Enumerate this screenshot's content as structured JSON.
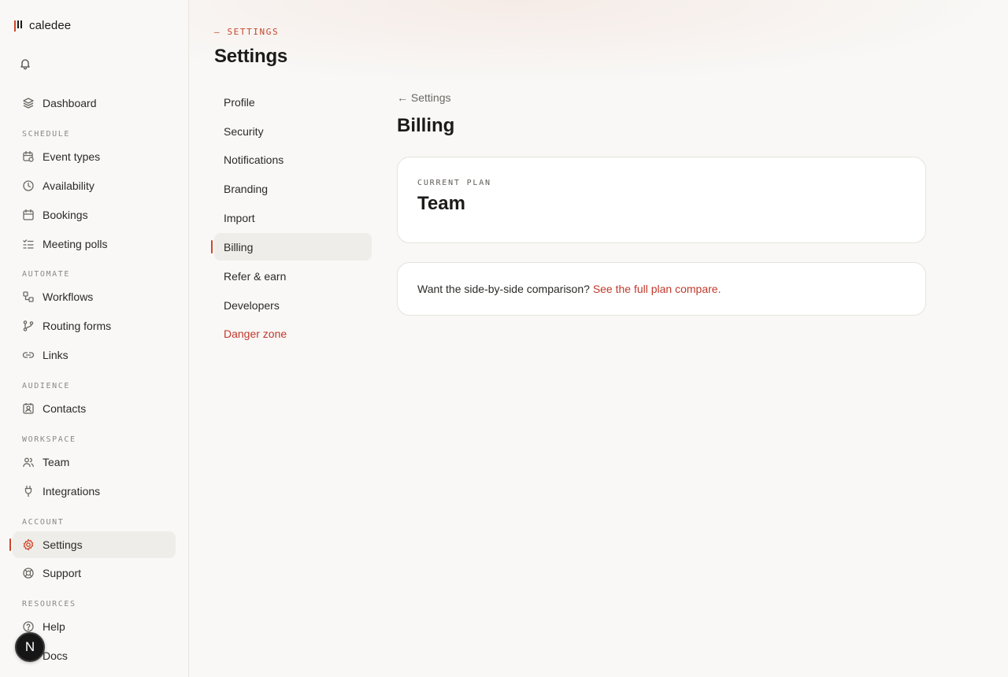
{
  "brand": {
    "name": "caledee"
  },
  "sidebar": {
    "sections": {
      "schedule": "SCHEDULE",
      "automate": "AUTOMATE",
      "audience": "AUDIENCE",
      "workspace": "WORKSPACE",
      "account": "ACCOUNT",
      "resources": "RESOURCES"
    },
    "items": {
      "dashboard": "Dashboard",
      "event_types": "Event types",
      "availability": "Availability",
      "bookings": "Bookings",
      "meeting_polls": "Meeting polls",
      "workflows": "Workflows",
      "routing_forms": "Routing forms",
      "links": "Links",
      "contacts": "Contacts",
      "team": "Team",
      "integrations": "Integrations",
      "settings": "Settings",
      "support": "Support",
      "help": "Help",
      "docs": "Docs"
    },
    "active": "settings",
    "avatar_initial": "N"
  },
  "header": {
    "eyebrow": "— SETTINGS",
    "title": "Settings"
  },
  "settings_nav": {
    "items": [
      "Profile",
      "Security",
      "Notifications",
      "Branding",
      "Import",
      "Billing",
      "Refer & earn",
      "Developers",
      "Danger zone"
    ],
    "active": "Billing"
  },
  "billing": {
    "back_label": "← Settings",
    "title": "Billing",
    "plan_label": "CURRENT PLAN",
    "plan_name": "Team",
    "compare_text": "Want the side-by-side comparison? ",
    "compare_link": "See the full plan compare."
  },
  "colors": {
    "accent": "#d0462a",
    "danger": "#c0392b",
    "background": "#f9f8f6"
  }
}
